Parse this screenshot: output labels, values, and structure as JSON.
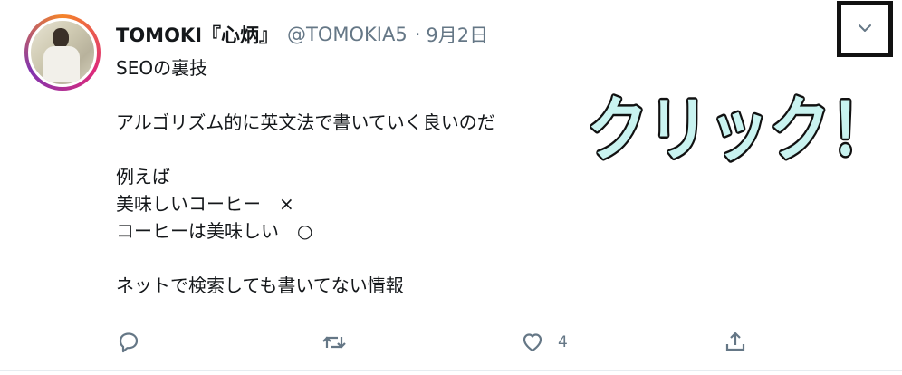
{
  "tweet": {
    "display_name": "TOMOKI『心炳』",
    "handle": "@TOMOKIA5",
    "separator": "·",
    "date": "9月2日",
    "lines": [
      "SEOの裏技",
      "",
      "アルゴリズム的に英文法で書いていく良いのだ",
      "",
      "例えば",
      "美味しいコーヒー　×",
      "コーヒーは美味しい　○",
      "",
      "ネットで検索しても書いてない情報"
    ]
  },
  "actions": {
    "reply_icon": "reply-icon",
    "retweet_icon": "retweet-icon",
    "like_icon": "heart-icon",
    "like_count": "4",
    "share_icon": "share-icon"
  },
  "menu": {
    "caret_icon": "chevron-down-icon"
  },
  "annotation": {
    "text": "クリック！"
  },
  "colors": {
    "text_primary": "#14171a",
    "text_secondary": "#657786",
    "annotation_fill": "#c9f3f0",
    "annotation_stroke": "#111111",
    "highlight_border": "#111111"
  }
}
